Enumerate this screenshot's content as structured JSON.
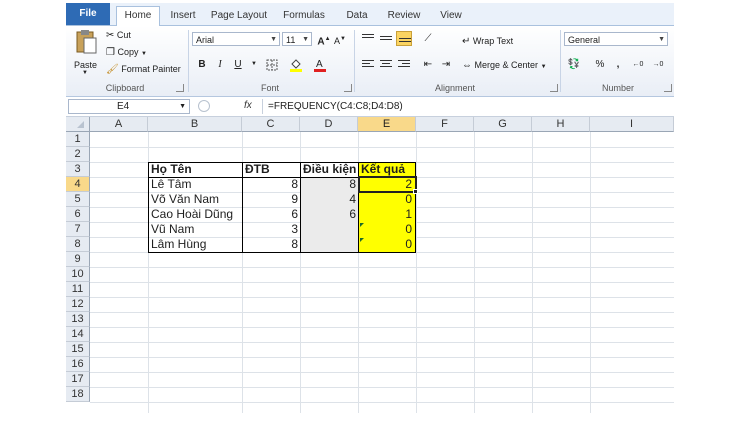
{
  "tabs": [
    "File",
    "Home",
    "Insert",
    "Page Layout",
    "Formulas",
    "Data",
    "Review",
    "View"
  ],
  "clipboard": {
    "paste": "Paste",
    "cut": "Cut",
    "copy": "Copy",
    "format_painter": "Format Painter",
    "group": "Clipboard"
  },
  "font": {
    "name": "Arial",
    "size": "11",
    "bold": "B",
    "italic": "I",
    "underline": "U",
    "group": "Font"
  },
  "alignment": {
    "wrap": "Wrap Text",
    "merge": "Merge & Center",
    "group": "Alignment"
  },
  "number": {
    "format": "General",
    "percent": "%",
    "comma": ",",
    "group": "Number"
  },
  "formula_bar": {
    "name_box": "E4",
    "fx": "fx",
    "formula": "=FREQUENCY(C4:C8;D4:D8)"
  },
  "columns": [
    "A",
    "B",
    "C",
    "D",
    "E",
    "F",
    "G",
    "H",
    "I"
  ],
  "rows": [
    "1",
    "2",
    "3",
    "4",
    "5",
    "6",
    "7",
    "8",
    "9",
    "10",
    "11",
    "12",
    "13",
    "14",
    "15",
    "16",
    "17",
    "18"
  ],
  "table": {
    "headers": [
      "Họ Tên",
      "ĐTB",
      "Điều kiện",
      "Kết quả"
    ],
    "rows": [
      [
        "Lê Tâm",
        "8",
        "8",
        "2"
      ],
      [
        "Võ Văn Nam",
        "9",
        "4",
        "0"
      ],
      [
        "Cao Hoài Dũng",
        "6",
        "6",
        "1"
      ],
      [
        "Vũ Nam",
        "3",
        "",
        "0"
      ],
      [
        "Lâm Hùng",
        "8",
        "",
        "0"
      ]
    ]
  },
  "colors": {
    "file_tab": "#2e6bb5",
    "result_fill": "#ffff00",
    "selected_header": "#f9d98a",
    "condition_fill": "#ebebeb"
  }
}
